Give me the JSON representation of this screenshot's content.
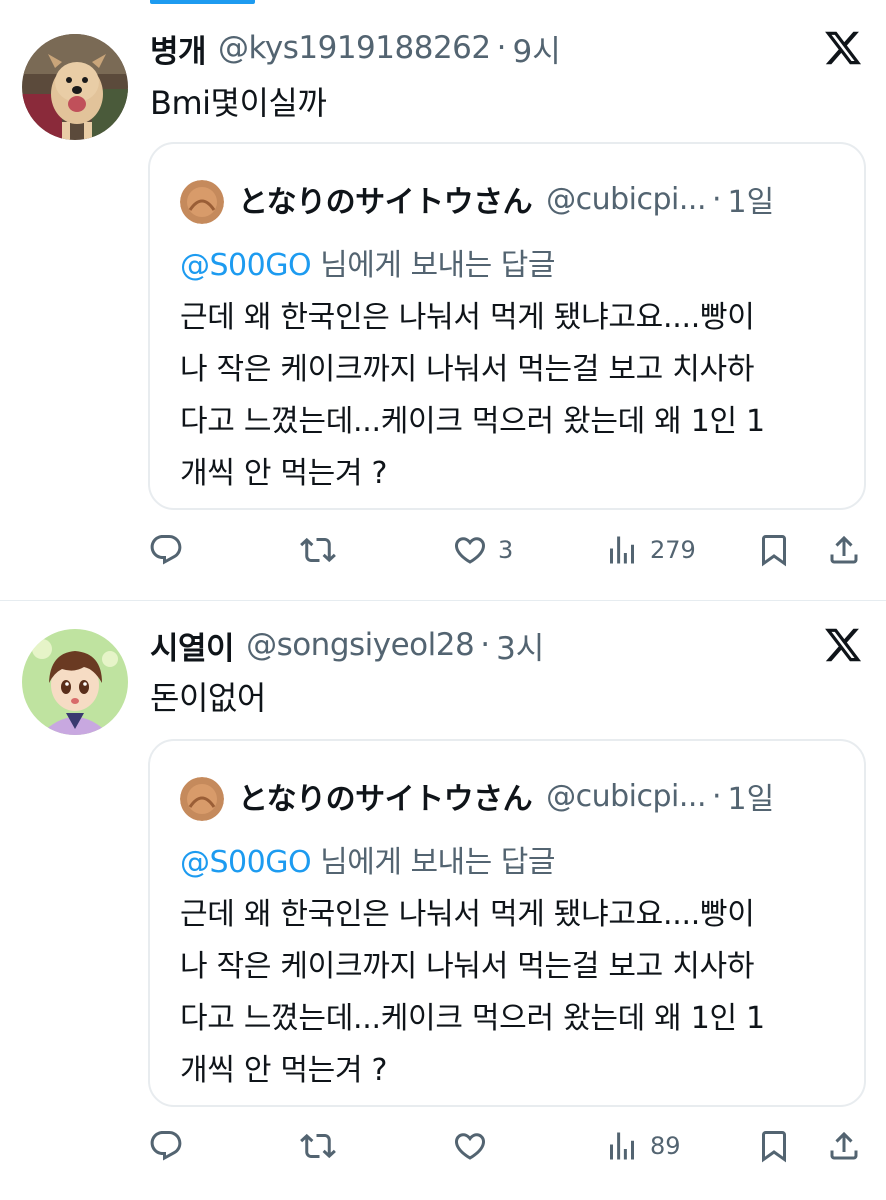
{
  "tweets": [
    {
      "name": "병개",
      "handle": "@kys1919188262",
      "dot": "·",
      "time": "9시",
      "text": "Bmi몇이실까",
      "quote": {
        "name": "となりのサイトウさん",
        "handle": "@cubicpi...",
        "dot": "·",
        "time": "1일",
        "mention": "@S00GO",
        "reply_suffix": " 님에게 보내는 답글",
        "lines": [
          "근데 왜 한국인은 나눠서 먹게 됐냐고요....빵이",
          "나 작은 케이크까지 나눠서 먹는걸 보고 치사하",
          "다고 느꼈는데...케이크 먹으러 왔는데 왜 1인 1",
          "개씩 안 먹는겨 ?"
        ]
      },
      "actions": {
        "likes": "3",
        "views": "279"
      }
    },
    {
      "name": "시열이",
      "handle": "@songsiyeol28",
      "dot": "·",
      "time": "3시",
      "text": "돈이없어",
      "quote": {
        "name": "となりのサイトウさん",
        "handle": "@cubicpi...",
        "dot": "·",
        "time": "1일",
        "mention": "@S00GO",
        "reply_suffix": " 님에게 보내는 답글",
        "lines": [
          "근데 왜 한국인은 나눠서 먹게 됐냐고요....빵이",
          "나 작은 케이크까지 나눠서 먹는걸 보고 치사하",
          "다고 느꼈는데...케이크 먹으러 왔는데 왜 1인 1",
          "개씩 안 먹는겨 ?"
        ]
      },
      "actions": {
        "likes": "",
        "views": "89"
      }
    }
  ],
  "icons": {
    "reply": "reply-icon",
    "retweet": "retweet-icon",
    "like": "heart-icon",
    "views": "views-icon",
    "bookmark": "bookmark-icon",
    "share": "share-icon",
    "brand": "x-logo-icon"
  },
  "colors": {
    "accent": "#1d9bf0",
    "text": "#0f1419",
    "secondary": "#536471",
    "border": "#e8ecef"
  }
}
